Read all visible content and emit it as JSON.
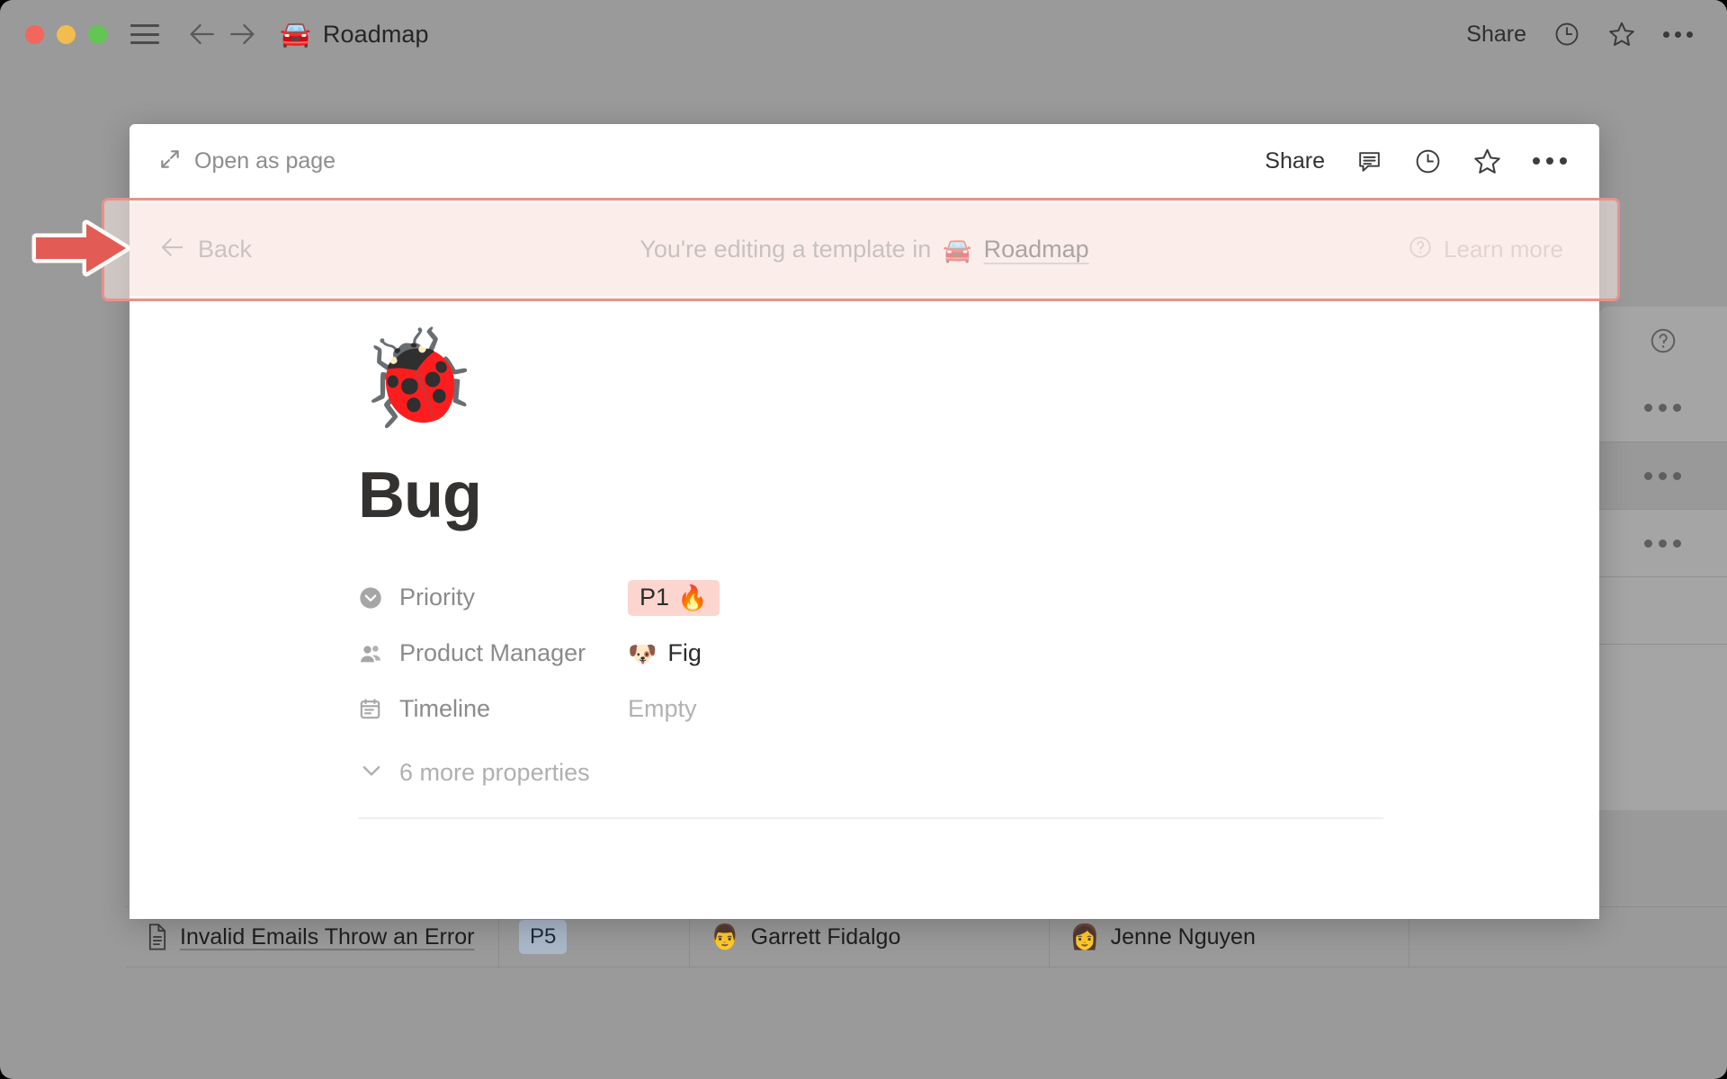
{
  "window": {
    "traffic_lights": [
      "close",
      "minimize",
      "maximize"
    ],
    "sidebar_toggle_icon": "hamburger-icon",
    "back_icon": "arrow-left-icon",
    "forward_icon": "arrow-right-icon",
    "breadcrumb_emoji": "🚘",
    "breadcrumb_title": "Roadmap",
    "share_label": "Share",
    "history_icon": "clock-icon",
    "favorite_icon": "star-icon",
    "more_icon": "ellipsis-icon"
  },
  "modal": {
    "open_as_page_label": "Open as page",
    "open_as_page_icon": "expand-arrows-icon",
    "share_label": "Share",
    "comment_icon": "comment-icon",
    "history_icon": "clock-icon",
    "favorite_icon": "star-icon",
    "more_icon": "ellipsis-icon"
  },
  "banner": {
    "back_label": "Back",
    "back_icon": "arrow-left-icon",
    "message": "You're editing a template in",
    "database_emoji": "🚘",
    "database_name": "Roadmap",
    "learn_more_label": "Learn more",
    "learn_more_icon": "question-circle-icon",
    "background_color": "#fbeeea",
    "highlight_border_color": "#e8918c"
  },
  "annotation": {
    "arrow_icon": "red-arrow-right-icon",
    "arrow_fill": "#e35b55",
    "arrow_outline": "#ffffff"
  },
  "page": {
    "emoji": "🐞",
    "title": "Bug",
    "properties": [
      {
        "icon": "select-icon",
        "label": "Priority",
        "value": "P1",
        "value_emoji": "🔥",
        "value_type": "chip",
        "chip_color": "#fcd5ce"
      },
      {
        "icon": "person-icon",
        "label": "Product Manager",
        "value": "Fig",
        "avatar": "🐶",
        "value_type": "person"
      },
      {
        "icon": "calendar-icon",
        "label": "Timeline",
        "value": "Empty",
        "value_type": "empty"
      }
    ],
    "more_properties_label": "6 more properties",
    "more_properties_icon": "chevron-down-icon"
  },
  "side_panel": {
    "help_icon": "question-circle-icon",
    "row_menus": [
      "ellipsis-icon",
      "ellipsis-icon",
      "ellipsis-icon"
    ]
  },
  "background_table": {
    "row": {
      "page_icon": "page-icon",
      "title": "Invalid Emails Throw an Error",
      "priority": "P5",
      "priority_color": "#aab8c9",
      "product_manager": {
        "avatar": "👨",
        "name": "Garrett Fidalgo"
      },
      "engineer": {
        "avatar": "👩",
        "name": "Jenne Nguyen"
      }
    }
  }
}
